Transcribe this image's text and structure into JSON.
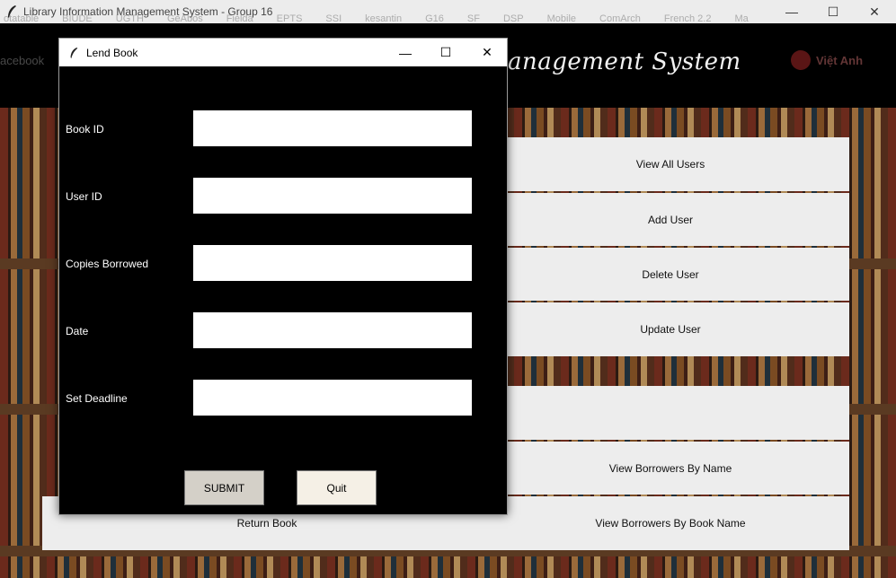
{
  "main_window": {
    "title": "Library Information Management System - Group 16",
    "heading_visible": "anagement System",
    "controls": {
      "minimize": "—",
      "maximize": "☐",
      "close": "✕"
    }
  },
  "ghost": {
    "bookmarks": [
      "otatable",
      "BIUDE",
      "UGTH",
      "GeAbos",
      "Fielda",
      "EPTS",
      "SSI",
      "kesantin",
      "G16",
      "SF",
      "DSP",
      "Mobile",
      "ComArch",
      "French 2.2",
      "Ma"
    ],
    "left": "acebook",
    "right": "Việt Anh"
  },
  "menu": {
    "view_all_users": "View All Users",
    "add_user": "Add User",
    "delete_user": "Delete User",
    "update_user": "Update User",
    "view_borrowers_by_name": "View Borrowers By Name",
    "return_book": "Return Book",
    "view_borrowers_by_book_name": "View Borrowers By Book Name"
  },
  "dialog": {
    "title": "Lend Book",
    "controls": {
      "minimize": "—",
      "maximize": "☐",
      "close": "✕"
    },
    "fields": [
      {
        "label": "Book ID",
        "value": ""
      },
      {
        "label": "User ID",
        "value": ""
      },
      {
        "label": "Copies Borrowed",
        "value": ""
      },
      {
        "label": "Date",
        "value": ""
      },
      {
        "label": "Set Deadline",
        "value": ""
      }
    ],
    "submit_label": "SUBMIT",
    "quit_label": "Quit",
    "colors": {
      "background": "#000000",
      "submit": "#d4d0c8",
      "quit": "#f5f0e6"
    }
  }
}
